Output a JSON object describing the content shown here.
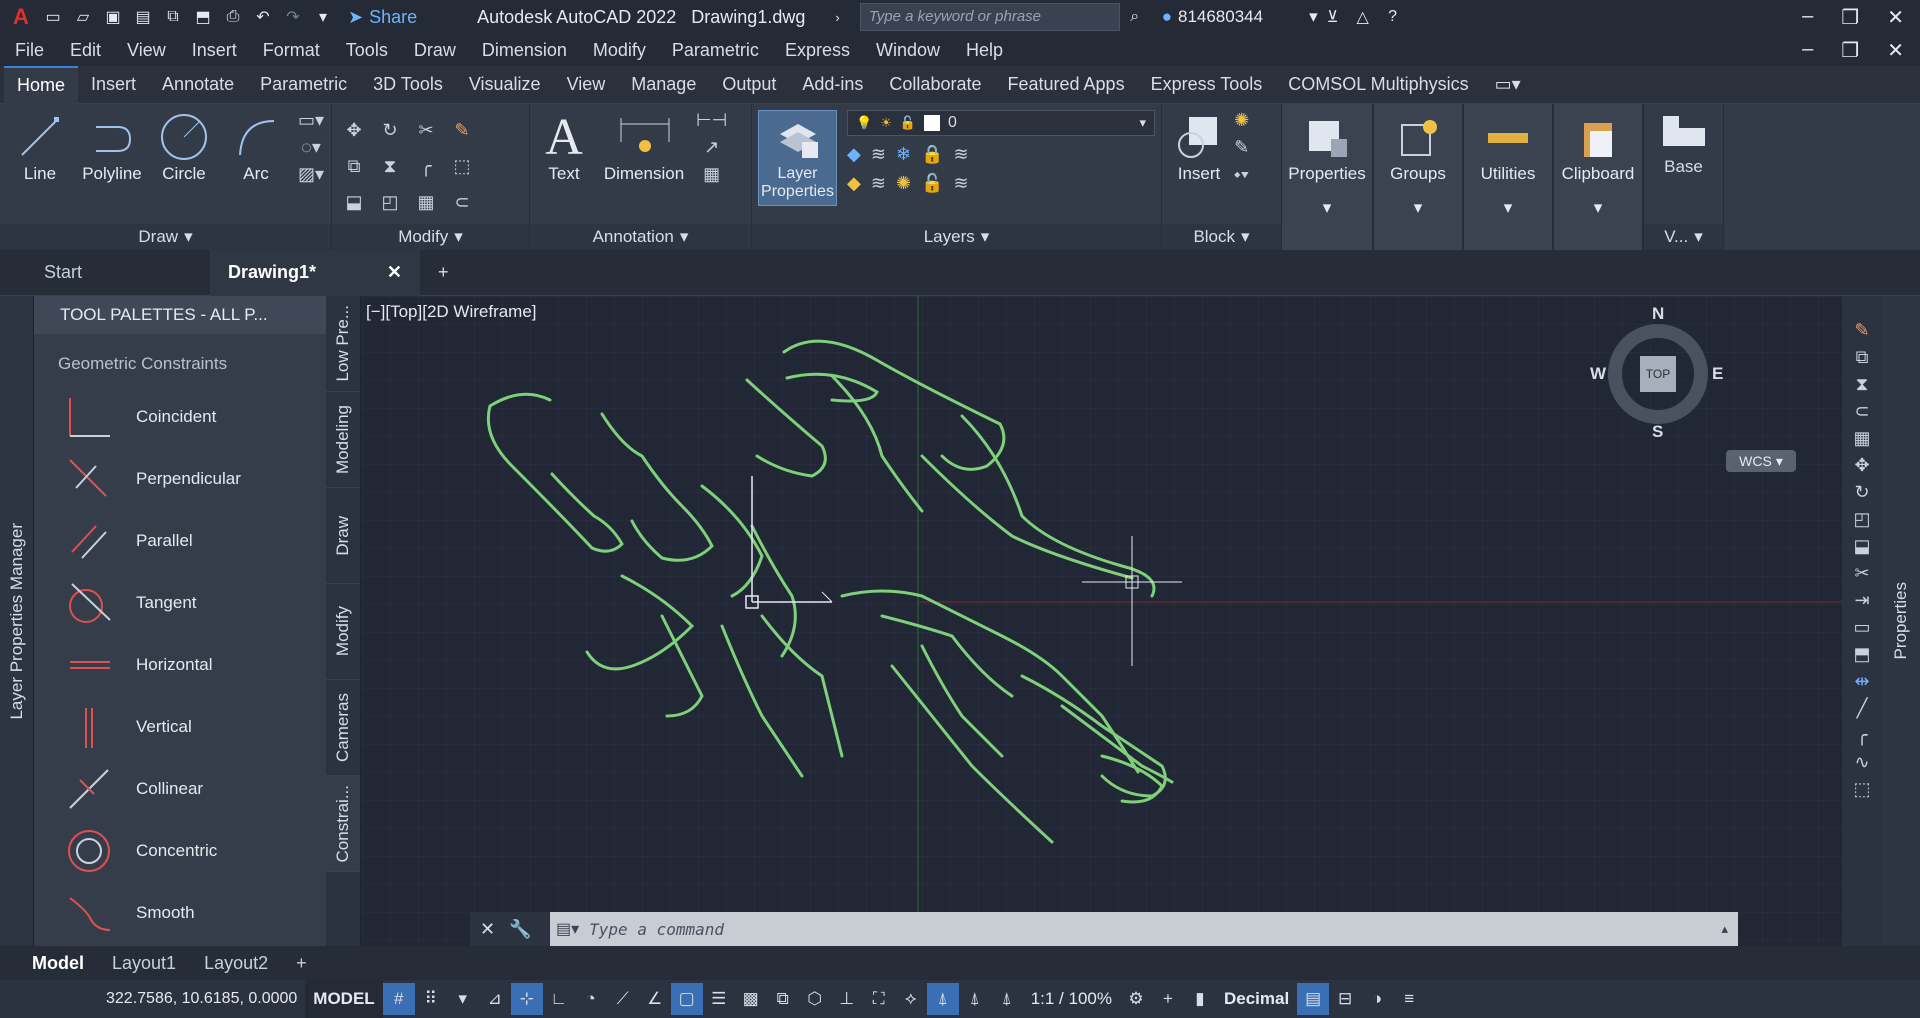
{
  "title": {
    "app_title": "Autodesk AutoCAD 2022",
    "file_name": "Drawing1.dwg",
    "share_label": "Share",
    "search_placeholder": "Type a keyword or phrase",
    "user_id": "814680344"
  },
  "menu": [
    "File",
    "Edit",
    "View",
    "Insert",
    "Format",
    "Tools",
    "Draw",
    "Dimension",
    "Modify",
    "Parametric",
    "Express",
    "Window",
    "Help"
  ],
  "ribbon_tabs": [
    "Home",
    "Insert",
    "Annotate",
    "Parametric",
    "3D Tools",
    "Visualize",
    "View",
    "Manage",
    "Output",
    "Add-ins",
    "Collaborate",
    "Featured Apps",
    "Express Tools",
    "COMSOL Multiphysics"
  ],
  "ribbon": {
    "draw": {
      "tools": [
        "Line",
        "Polyline",
        "Circle",
        "Arc"
      ],
      "panel_label": "Draw"
    },
    "modify": {
      "panel_label": "Modify"
    },
    "annotation": {
      "text_label": "Text",
      "dimension_label": "Dimension",
      "panel_label": "Annotation"
    },
    "layers": {
      "layer_properties_label": "Layer Properties",
      "current_layer": "0",
      "panel_label": "Layers"
    },
    "block": {
      "insert_label": "Insert",
      "panel_label": "Block"
    },
    "properties_label": "Properties",
    "groups_label": "Groups",
    "utilities_label": "Utilities",
    "clipboard_label": "Clipboard",
    "base_label": "Base",
    "view_panel_label": "V..."
  },
  "doc_tabs": {
    "start": "Start",
    "active": "Drawing1*"
  },
  "left_strip_label": "Layer Properties Manager",
  "palette": {
    "header": "TOOL PALETTES - ALL P...",
    "group": "Geometric Constraints",
    "items": [
      "Coincident",
      "Perpendicular",
      "Parallel",
      "Tangent",
      "Horizontal",
      "Vertical",
      "Collinear",
      "Concentric",
      "Smooth"
    ],
    "side_tabs": [
      "Low Pre...",
      "Modeling",
      "Draw",
      "Modify",
      "Cameras",
      "Constrai..."
    ]
  },
  "viewport": {
    "label": "[−][Top][2D Wireframe]",
    "compass": {
      "n": "N",
      "s": "S",
      "e": "E",
      "w": "W",
      "top": "TOP",
      "wcs": "WCS"
    }
  },
  "right_strip_label": "Properties",
  "command": {
    "placeholder": "Type a command"
  },
  "layout_tabs": [
    "Model",
    "Layout1",
    "Layout2"
  ],
  "status": {
    "coords": "322.7586, 10.6185, 0.0000",
    "mode": "MODEL",
    "scale": "1:1 / 100%",
    "units": "Decimal"
  },
  "colors": {
    "accent": "#3b82d8",
    "drawing": "#7fd07a",
    "background": "#212735"
  }
}
